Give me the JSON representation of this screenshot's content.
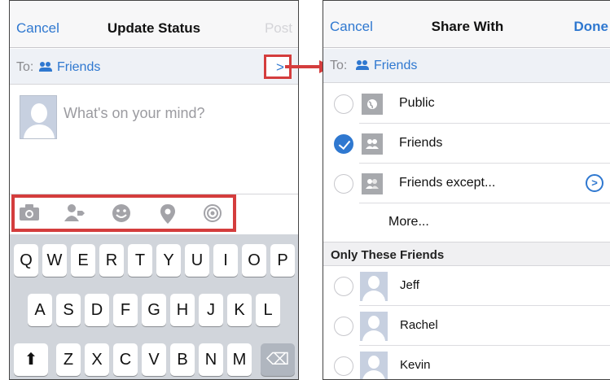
{
  "left_screen": {
    "cancel": "Cancel",
    "title": "Update Status",
    "post": "Post",
    "to_label": "To:",
    "to_value": "Friends",
    "to_chevron": ">",
    "composer_placeholder": "What's on your mind?",
    "attachments": [
      "camera-icon",
      "tag-people-icon",
      "emoji-icon",
      "location-icon",
      "audio-icon"
    ],
    "keyboard": {
      "row1": [
        "Q",
        "W",
        "E",
        "R",
        "T",
        "Y",
        "U",
        "I",
        "O",
        "P"
      ],
      "row2": [
        "A",
        "S",
        "D",
        "F",
        "G",
        "H",
        "J",
        "K",
        "L"
      ],
      "row3": [
        "Z",
        "X",
        "C",
        "V",
        "B",
        "N",
        "M"
      ],
      "shift": "⬆",
      "delete": "⌫"
    }
  },
  "right_screen": {
    "cancel": "Cancel",
    "title": "Share With",
    "done": "Done",
    "to_label": "To:",
    "to_value": "Friends",
    "options": [
      {
        "label": "Public",
        "icon": "globe-icon",
        "checked": false
      },
      {
        "label": "Friends",
        "icon": "friends-icon",
        "checked": true
      },
      {
        "label": "Friends except...",
        "icon": "friends-except-icon",
        "checked": false
      }
    ],
    "info_glyph": ">",
    "more": "More...",
    "section_header": "Only These Friends",
    "friends": [
      {
        "name": "Jeff"
      },
      {
        "name": "Rachel"
      },
      {
        "name": "Kevin"
      }
    ]
  },
  "colors": {
    "accent": "#2f78d0",
    "highlight": "#d43d3d"
  }
}
